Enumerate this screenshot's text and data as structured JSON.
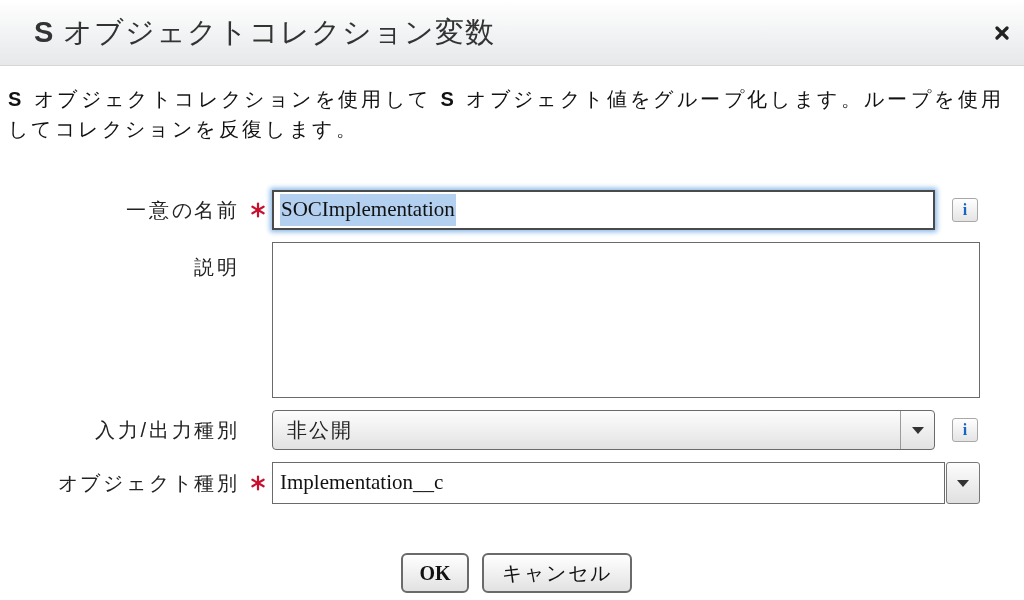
{
  "dialog": {
    "title": "**S** オブジェクトコレクション変数"
  },
  "description": "**S** オブジェクトコレクションを使用して **S** オブジェクト値をグループ化します。ループを使用してコレクションを反復します。",
  "fields": [
    {
      "kind": "text",
      "label": "一意の名前",
      "required": true,
      "value": "SOCImplementation",
      "focused": true,
      "text_selected": true,
      "info": "i"
    },
    {
      "kind": "textarea",
      "label": "説明",
      "required": false,
      "focused": false
    },
    {
      "kind": "select",
      "label": "入力/出力種別",
      "required": false,
      "value": "非公開",
      "focused": false,
      "text_selected": false,
      "info": "i"
    },
    {
      "kind": "combobox",
      "label": "オブジェクト種別",
      "required": true,
      "value": "Implementation__c",
      "focused": false,
      "text_selected": false
    }
  ],
  "buttons": [
    "OK",
    "キャンセル"
  ]
}
